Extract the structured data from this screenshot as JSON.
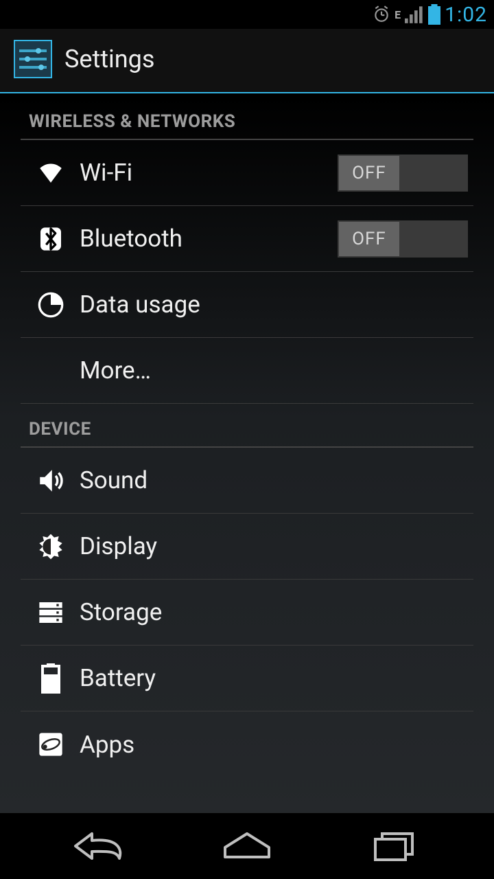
{
  "status": {
    "network_type": "E",
    "time": "1:02"
  },
  "header": {
    "title": "Settings"
  },
  "sections": {
    "wireless": {
      "header": "WIRELESS & NETWORKS",
      "wifi": {
        "label": "Wi-Fi",
        "toggle": "OFF"
      },
      "bluetooth": {
        "label": "Bluetooth",
        "toggle": "OFF"
      },
      "data_usage": {
        "label": "Data usage"
      },
      "more": {
        "label": "More…"
      }
    },
    "device": {
      "header": "DEVICE",
      "sound": {
        "label": "Sound"
      },
      "display": {
        "label": "Display"
      },
      "storage": {
        "label": "Storage"
      },
      "battery": {
        "label": "Battery"
      },
      "apps": {
        "label": "Apps"
      }
    }
  }
}
